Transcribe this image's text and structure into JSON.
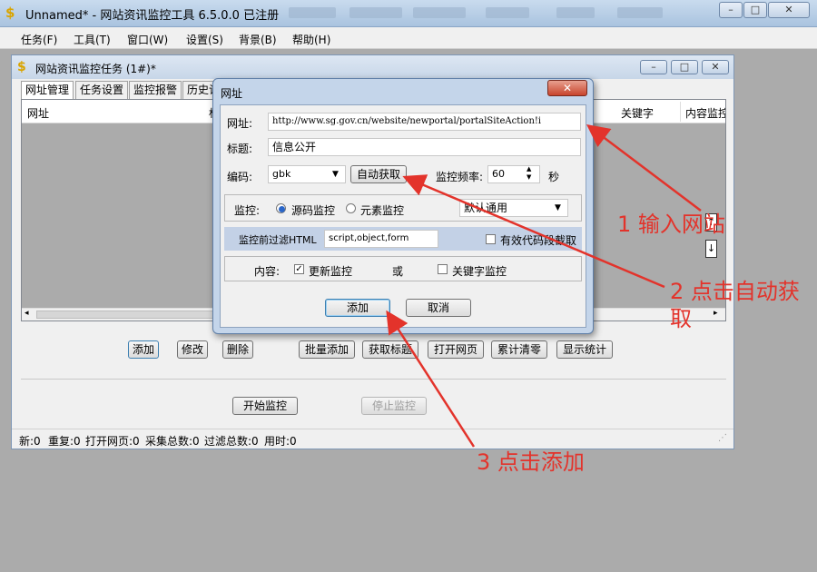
{
  "window": {
    "title": "Unnamed* - 网站资讯监控工具 6.5.0.0 已注册"
  },
  "menu": [
    "任务(F)",
    "工具(T)",
    "窗口(W)",
    "设置(S)",
    "背景(B)",
    "帮助(H)"
  ],
  "child": {
    "title": "网站资讯监控任务 (1#)*",
    "tabs": [
      "网址管理",
      "任务设置",
      "监控报警",
      "历史记"
    ],
    "columns": [
      "网址",
      "标",
      "关键字",
      "内容监控"
    ],
    "buttons": [
      "添加",
      "修改",
      "删除",
      "批量添加",
      "获取标题",
      "打开网页",
      "累计清零",
      "显示统计"
    ],
    "start_label": "开始监控",
    "stop_label": "停止监控",
    "status": [
      "新:0",
      "重复:0",
      "打开网页:0",
      "采集总数:0",
      "过滤总数:0",
      "用时:0"
    ]
  },
  "dialog": {
    "title": "网址",
    "url_label": "网址:",
    "url_value": "http://www.sg.gov.cn/website/newportal/portalSiteAction!i",
    "title_label": "标题:",
    "title_value": "信息公开",
    "encoding_label": "编码:",
    "encoding_value": "gbk",
    "auto_label": "自动获取",
    "freq_label": "监控频率:",
    "freq_value": "60",
    "freq_unit": "秒",
    "monitor_label": "监控:",
    "radio_source": "源码监控",
    "radio_element": "元素监控",
    "mode_value": "默认通用",
    "filter_label": "监控前过滤HTML",
    "filter_value": "script,object,form",
    "valid_label": "有效代码段截取",
    "content_label": "内容:",
    "update_label": "更新监控",
    "or_label": "或",
    "keyword_label": "关键字监控",
    "add_label": "添加",
    "cancel_label": "取消"
  },
  "annotations": {
    "a1": "1 输入网站",
    "a2_line1": "2 点击自动获",
    "a2_line2": "取",
    "a3": "3 点击添加"
  },
  "colors": {
    "annotation": "#e3332b",
    "dialog_frame": "#c4d5ea",
    "filter_band": "#c3d1e6"
  }
}
